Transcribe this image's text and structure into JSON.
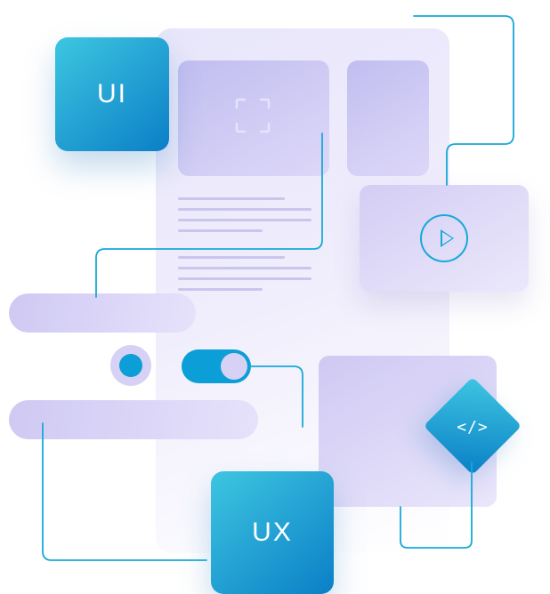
{
  "tiles": {
    "ui_label": "UI",
    "ux_label": "UX",
    "code_label": "</>"
  },
  "icons": {
    "focus": "focus-brackets",
    "play": "play-circle",
    "code": "code-diamond"
  },
  "colors": {
    "brand_cyan": "#3dc6e0",
    "brand_blue": "#0b7fc7",
    "lavender_light": "#e8e6fa",
    "lavender_mid": "#cfc9f3",
    "stroke": "#16a9d9"
  },
  "controls": {
    "radio_selected": true,
    "toggle_on": true
  },
  "text_lines": {
    "group1": [
      120,
      150,
      150,
      95
    ],
    "group2": [
      120,
      150,
      150,
      95
    ]
  }
}
